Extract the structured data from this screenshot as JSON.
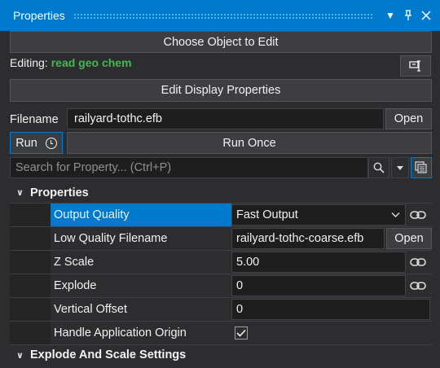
{
  "panel": {
    "title": "Properties"
  },
  "toolbar": {
    "choose_object_label": "Choose Object to Edit",
    "editing_label": "Editing:",
    "editing_object": "read geo chem",
    "edit_display_label": "Edit Display Properties"
  },
  "file": {
    "label": "Filename",
    "value": "railyard-tothc.efb",
    "open_label": "Open"
  },
  "run": {
    "run_label": "Run",
    "run_once_label": "Run Once"
  },
  "search": {
    "placeholder": "Search for Property... (Ctrl+P)"
  },
  "grid": {
    "categories": [
      "Properties",
      "Explode And Scale Settings"
    ],
    "rows": [
      {
        "name": "Output Quality",
        "value": "Fast Output",
        "selected": true
      },
      {
        "name": "Low Quality Filename",
        "value": "railyard-tothc-coarse.efb",
        "button": "Open"
      },
      {
        "name": "Z Scale",
        "value": "5.00"
      },
      {
        "name": "Explode",
        "value": "0"
      },
      {
        "name": "Vertical Offset",
        "value": "0"
      },
      {
        "name": "Handle Application Origin",
        "checked": true
      }
    ]
  },
  "colors": {
    "accent": "#007acc",
    "object_name": "#3fb950"
  }
}
